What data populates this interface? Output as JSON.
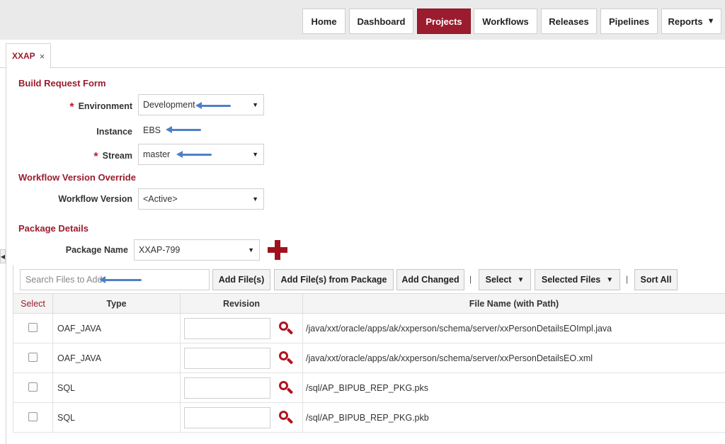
{
  "nav": {
    "home": "Home",
    "dashboard": "Dashboard",
    "projects": "Projects",
    "workflows": "Workflows",
    "releases": "Releases",
    "pipelines": "Pipelines",
    "reports": "Reports",
    "active_color": "#9b1c2e"
  },
  "tab": {
    "label": "XXAP",
    "close": "×"
  },
  "form": {
    "title": "Build Request Form",
    "required_marker": "*",
    "environment_label": "Environment",
    "environment_value": "Development",
    "instance_label": "Instance",
    "instance_value": "EBS",
    "stream_label": "Stream",
    "stream_value": "master"
  },
  "override": {
    "title": "Workflow Version Override",
    "workflow_version_label": "Workflow Version",
    "workflow_version_value": "<Active>"
  },
  "package": {
    "title": "Package Details",
    "name_label": "Package Name",
    "name_value": "XXAP-799",
    "add_icon": "plus-icon"
  },
  "toolbar": {
    "search_placeholder": "Search Files to Add",
    "add_files": "Add File(s)",
    "add_from_package": "Add File(s) from Package",
    "add_changed": "Add Changed",
    "separator": "|",
    "select": "Select",
    "selected_files": "Selected Files",
    "sort_all": "Sort All"
  },
  "table": {
    "headers": {
      "select": "Select",
      "type": "Type",
      "revision": "Revision",
      "file": "File Name (with Path)"
    },
    "rows": [
      {
        "type": "OAF_JAVA",
        "revision": "",
        "file": "/java/xxt/oracle/apps/ak/xxperson/schema/server/xxPersonDetailsEOImpl.java"
      },
      {
        "type": "OAF_JAVA",
        "revision": "",
        "file": "/java/xxt/oracle/apps/ak/xxperson/schema/server/xxPersonDetailsEO.xml"
      },
      {
        "type": "SQL",
        "revision": "",
        "file": "/sql/AP_BIPUB_REP_PKG.pks"
      },
      {
        "type": "SQL",
        "revision": "",
        "file": "/sql/AP_BIPUB_REP_PKG.pkb"
      }
    ]
  }
}
